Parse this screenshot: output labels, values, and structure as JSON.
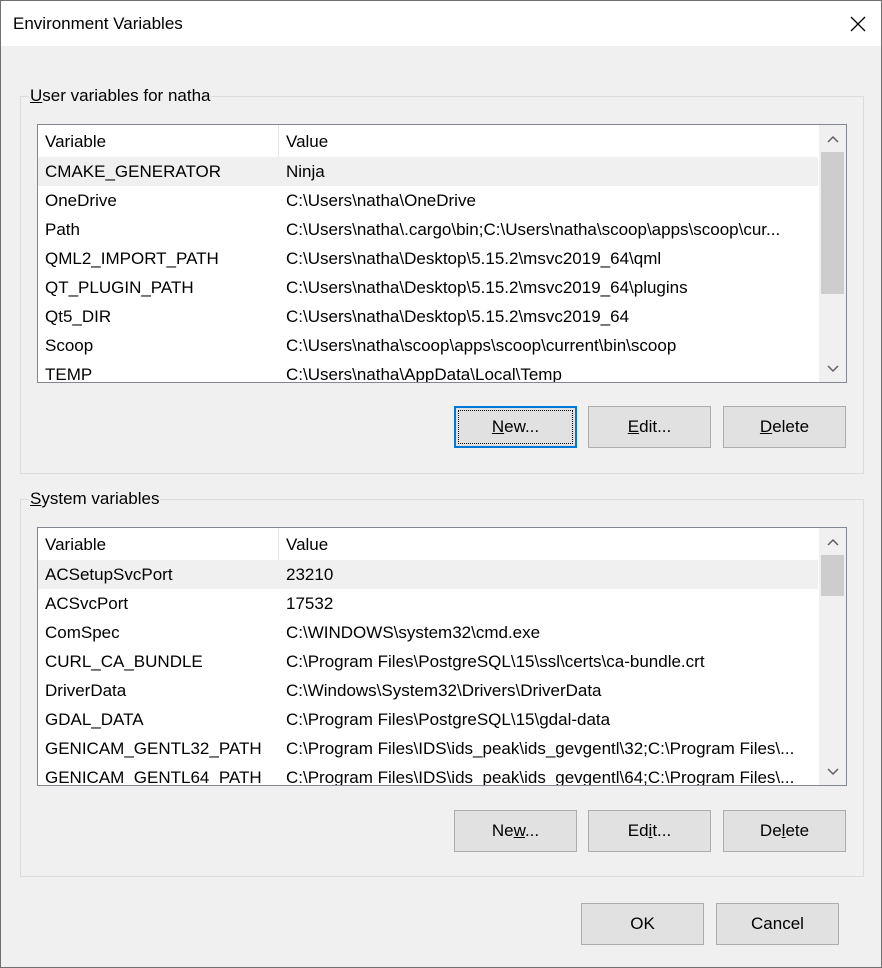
{
  "window": {
    "title": "Environment Variables"
  },
  "user_group": {
    "label_prefix": "",
    "label_mnemonic": "U",
    "label_rest": "ser variables for natha",
    "columns": [
      "Variable",
      "Value"
    ],
    "rows": [
      {
        "variable": "CMAKE_GENERATOR",
        "value": "Ninja",
        "selected": true
      },
      {
        "variable": "OneDrive",
        "value": "C:\\Users\\natha\\OneDrive"
      },
      {
        "variable": "Path",
        "value": "C:\\Users\\natha\\.cargo\\bin;C:\\Users\\natha\\scoop\\apps\\scoop\\cur..."
      },
      {
        "variable": "QML2_IMPORT_PATH",
        "value": "C:\\Users\\natha\\Desktop\\5.15.2\\msvc2019_64\\qml"
      },
      {
        "variable": "QT_PLUGIN_PATH",
        "value": "C:\\Users\\natha\\Desktop\\5.15.2\\msvc2019_64\\plugins"
      },
      {
        "variable": "Qt5_DIR",
        "value": "C:\\Users\\natha\\Desktop\\5.15.2\\msvc2019_64"
      },
      {
        "variable": "Scoop",
        "value": "C:\\Users\\natha\\scoop\\apps\\scoop\\current\\bin\\scoop"
      },
      {
        "variable": "TEMP",
        "value": "C:\\Users\\natha\\AppData\\Local\\Temp"
      }
    ],
    "buttons": {
      "new": {
        "mnemonic": "N",
        "rest": "ew..."
      },
      "edit": {
        "mnemonic": "E",
        "rest": "dit..."
      },
      "delete": {
        "mnemonic": "D",
        "rest": "elete"
      }
    },
    "scroll_position": 0.0,
    "scroll_visible_fraction": 0.7
  },
  "system_group": {
    "label_mnemonic": "S",
    "label_rest": "ystem variables",
    "columns": [
      "Variable",
      "Value"
    ],
    "rows": [
      {
        "variable": "ACSetupSvcPort",
        "value": "23210",
        "selected": true
      },
      {
        "variable": "ACSvcPort",
        "value": "17532"
      },
      {
        "variable": "ComSpec",
        "value": "C:\\WINDOWS\\system32\\cmd.exe"
      },
      {
        "variable": "CURL_CA_BUNDLE",
        "value": "C:\\Program Files\\PostgreSQL\\15\\ssl\\certs\\ca-bundle.crt"
      },
      {
        "variable": "DriverData",
        "value": "C:\\Windows\\System32\\Drivers\\DriverData"
      },
      {
        "variable": "GDAL_DATA",
        "value": "C:\\Program Files\\PostgreSQL\\15\\gdal-data"
      },
      {
        "variable": "GENICAM_GENTL32_PATH",
        "value": "C:\\Program Files\\IDS\\ids_peak\\ids_gevgentl\\32;C:\\Program Files\\..."
      },
      {
        "variable": "GENICAM_GENTL64_PATH",
        "value": "C:\\Program Files\\IDS\\ids_peak\\ids_gevgentl\\64;C:\\Program Files\\..."
      }
    ],
    "buttons": {
      "new": {
        "before": "Ne",
        "mnemonic": "w",
        "rest": "..."
      },
      "edit": {
        "before": "Ed",
        "mnemonic": "i",
        "rest": "t..."
      },
      "delete": {
        "before": "De",
        "mnemonic": "l",
        "rest": "ete"
      }
    },
    "scroll_position": 0.0,
    "scroll_visible_fraction": 0.2
  },
  "footer": {
    "ok_label": "OK",
    "cancel_label": "Cancel"
  }
}
